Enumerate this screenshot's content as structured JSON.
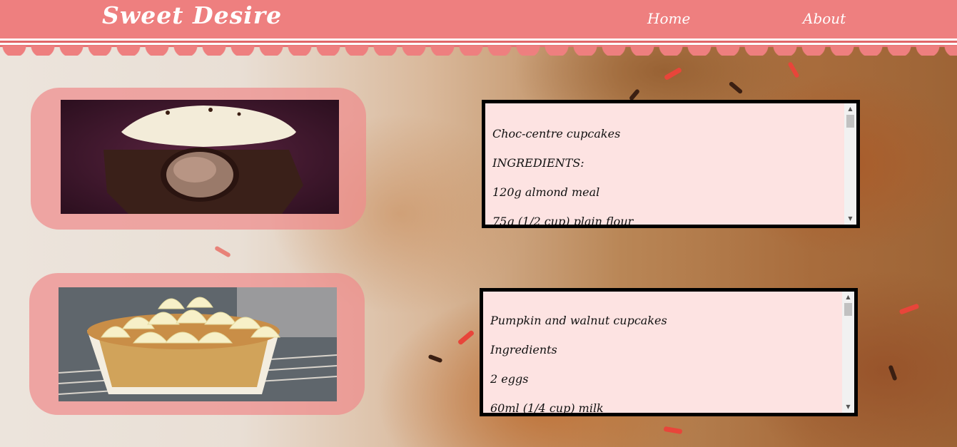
{
  "navbar": {
    "title": "Sweet Desire",
    "links": [
      {
        "label": "Home"
      },
      {
        "label": "About"
      }
    ]
  },
  "recipes": [
    {
      "title": "Choc-centre cupcakes",
      "heading": "INGREDIENTS:",
      "lines": [
        "120g almond meal",
        "75g (1/2 cup) plain flour"
      ]
    },
    {
      "title": "Pumpkin and walnut cupcakes",
      "heading": "Ingredients",
      "lines": [
        "2 eggs",
        "60ml (1/4 cup) milk"
      ]
    }
  ],
  "colors": {
    "navbar": "#ee7f7f",
    "frame": "#ee8c8c",
    "recipe_bg": "#fde3e2"
  }
}
